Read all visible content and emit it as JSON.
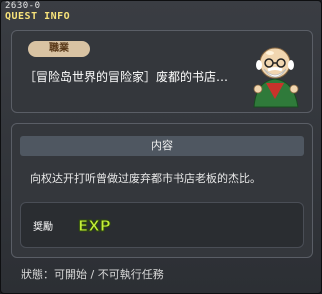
{
  "window": {
    "quest_id": "2630-0",
    "title": "QUEST INFO"
  },
  "quest": {
    "job_tag": "職業",
    "title": "［冒险岛世界的冒险家］废都的书店…",
    "npc_icon": "old-scholar-npc"
  },
  "content": {
    "header": "内容",
    "description": "向权达开打听曾做过废弃都市书店老板的杰比。"
  },
  "reward": {
    "label": "奨勵",
    "exp_text": "EXP",
    "exp_color": "#c6f03a"
  },
  "status": {
    "text": "狀態：可開始 / 不可執行任務"
  }
}
